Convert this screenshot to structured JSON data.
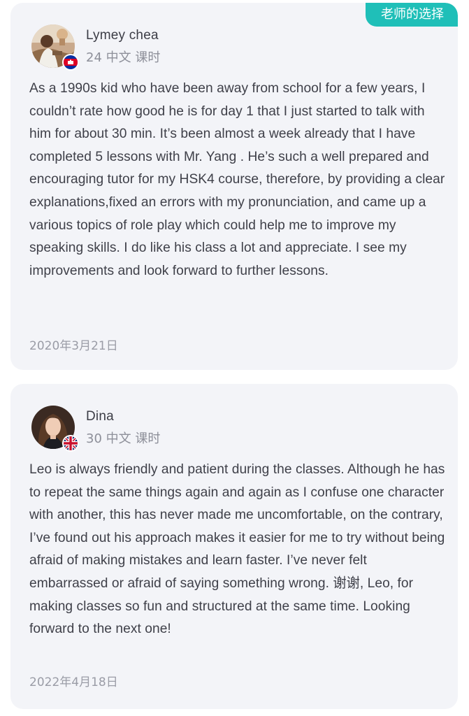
{
  "reviews": [
    {
      "badge": "老师的选择",
      "name": "Lymey chea",
      "lessons": "24 中文 课时",
      "text": "As a 1990s kid who have been away from school for a few years, I couldn’t rate how good he is for day 1 that I just started to talk with him for about 30 min. It’s been almost a week already that I have completed 5 lessons with Mr. Yang . He’s such a well prepared and encouraging tutor for my HSK4 course, therefore, by providing a clear explanations,fixed an errors with my pronunciation, and came up a various topics of role play which could help me to improve my speaking skills. I do like his class a lot and appreciate. I see my improvements and look forward to further lessons.",
      "date": "2020年3月21日",
      "flag": "cambodia-flag-icon"
    },
    {
      "name": "Dina",
      "lessons": "30 中文 课时",
      "text": "Leo is always friendly and patient during the classes. Although he has to repeat the same things again and again as I confuse one character with another, this has never made me uncomfortable, on the contrary, I’ve found out his approach makes it easier for me to try without being afraid of making mistakes and learn faster. I’ve never felt embarrassed or afraid of saying something wrong. 谢谢, Leo, for making classes so fun and structured at the same time. Looking forward to the next one!",
      "date": "2022年4月18日",
      "flag": "uk-flag-icon"
    }
  ],
  "colors": {
    "card_bg": "#f3f4f8",
    "badge_bg": "#1fbfb8",
    "text": "#3f4049",
    "muted": "#8d8f99"
  }
}
